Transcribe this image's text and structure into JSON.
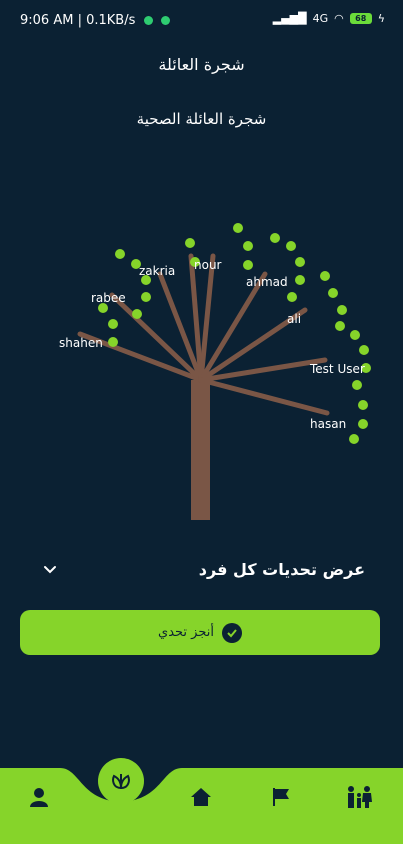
{
  "status_bar": {
    "time_speed": "9:06 AM | 0.1KB/s",
    "network": "4G",
    "battery": "68"
  },
  "header": {
    "title": "شجرة العائلة"
  },
  "tree": {
    "title": "شجرة العائلة الصحية",
    "members": [
      "zakria",
      "nour",
      "ahmad",
      "rabee",
      "ali",
      "shahen",
      "Test User",
      "hasan"
    ],
    "colors": {
      "trunk": "#7a5646",
      "dots": "#86d42a"
    }
  },
  "challenges": {
    "dropdown_label": "عرض تحديات كل فرد",
    "complete_button": "أنجز تحدي"
  },
  "nav": {
    "items": [
      "profile-icon",
      "plant-icon",
      "home-icon",
      "flag-icon",
      "family-icon"
    ],
    "accent": "#86d42a"
  }
}
